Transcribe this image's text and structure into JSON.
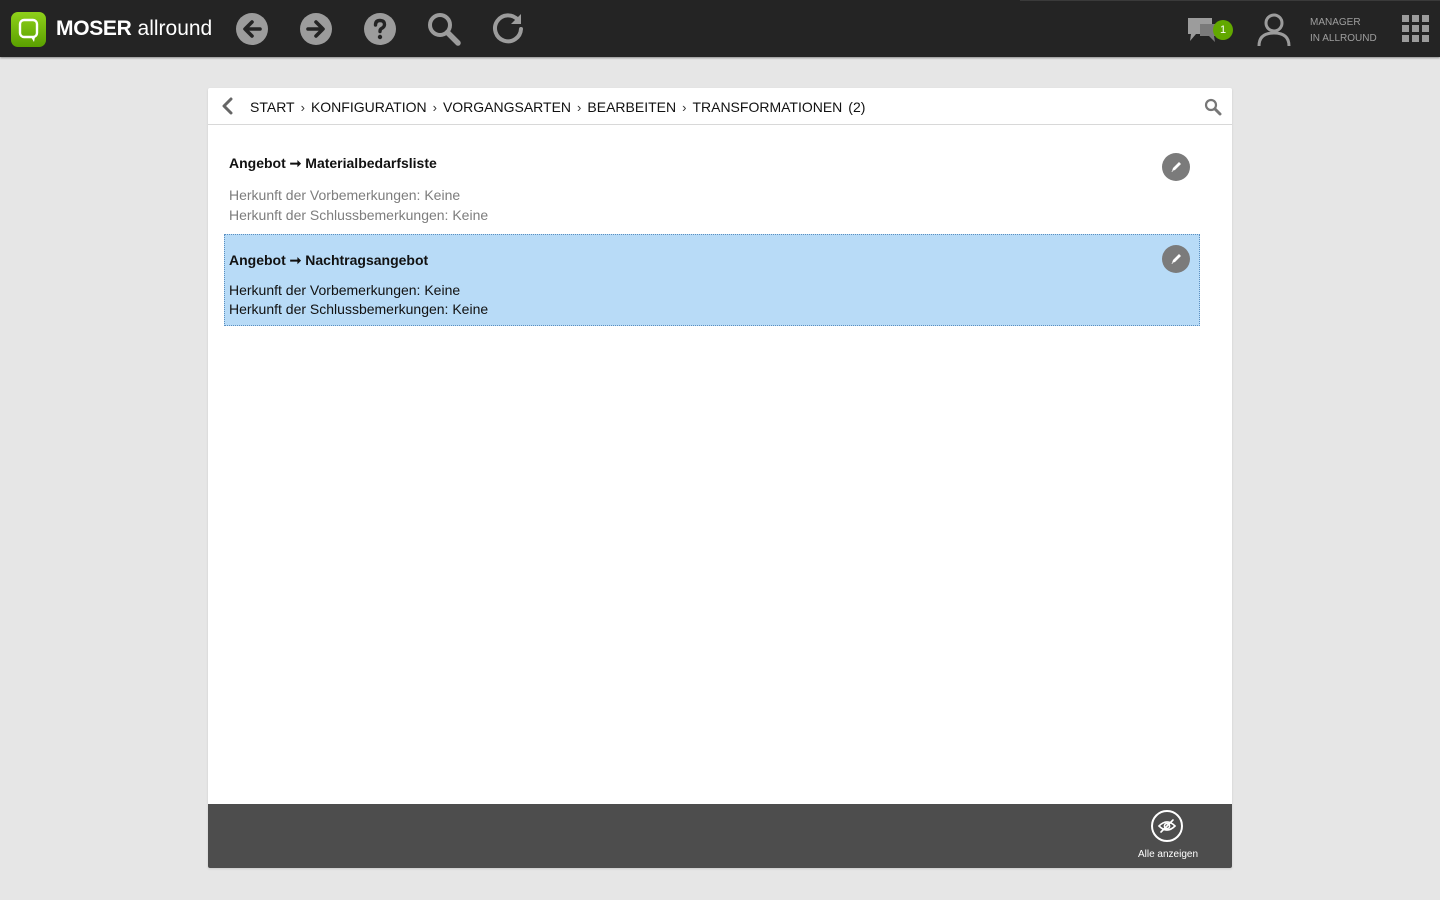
{
  "app": {
    "brand_bold": "MOSER",
    "brand_light": "allround"
  },
  "toolbar": {
    "icons": [
      "back-arrow-icon",
      "forward-arrow-icon",
      "help-icon",
      "search-icon",
      "reload-icon"
    ],
    "chat_badge": "1",
    "user_role": "MANAGER",
    "user_company": "IN ALLROUND"
  },
  "breadcrumb": {
    "items": [
      "START",
      "KONFIGURATION",
      "VORGANGSARTEN",
      "BEARBEITEN",
      "TRANSFORMATIONEN"
    ],
    "count": "(2)",
    "separator": "›"
  },
  "list": {
    "items": [
      {
        "source": "Angebot",
        "arrow": "➞",
        "target": "Materialbedarfsliste",
        "line1": "Herkunft der Vorbemerkungen: Keine",
        "line2": "Herkunft der Schlussbemerkungen: Keine",
        "selected": false
      },
      {
        "source": "Angebot",
        "arrow": "➞",
        "target": "Nachtragsangebot",
        "line1": "Herkunft der Vorbemerkungen: Keine",
        "line2": "Herkunft der Schlussbemerkungen: Keine",
        "selected": true
      }
    ]
  },
  "footer": {
    "show_all_label": "Alle anzeigen"
  },
  "colors": {
    "topbar": "#242424",
    "brand_green": "#6fb900",
    "selection": "#b8dbf7",
    "footer": "#4d4d4d",
    "background": "#e6e6e6"
  }
}
